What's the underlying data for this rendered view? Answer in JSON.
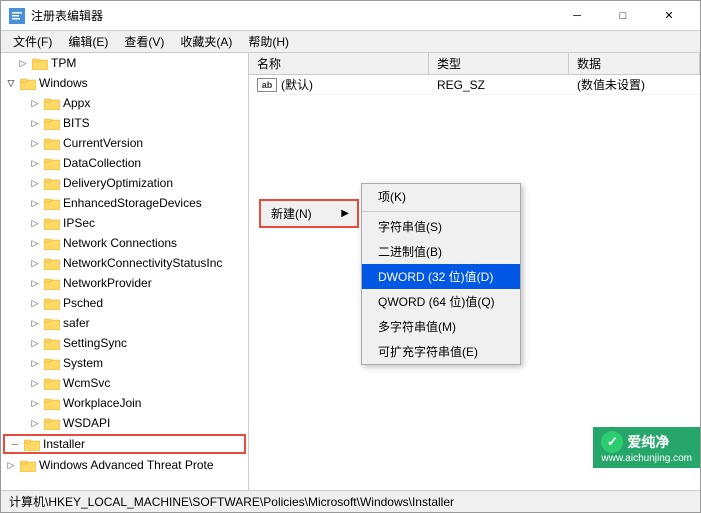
{
  "window": {
    "title": "注册表编辑器",
    "icon": "registry-editor-icon"
  },
  "titlebar": {
    "minimize": "─",
    "maximize": "□",
    "close": "✕"
  },
  "menu": {
    "items": [
      {
        "label": "文件(F)"
      },
      {
        "label": "编辑(E)"
      },
      {
        "label": "查看(V)"
      },
      {
        "label": "收藏夹(A)"
      },
      {
        "label": "帮助(H)"
      }
    ]
  },
  "tree": {
    "items": [
      {
        "id": "tpm",
        "label": "TPM",
        "indent": 1,
        "expanded": false,
        "hasChildren": true
      },
      {
        "id": "windows",
        "label": "Windows",
        "indent": 1,
        "expanded": true,
        "hasChildren": true
      },
      {
        "id": "appx",
        "label": "Appx",
        "indent": 2,
        "expanded": false,
        "hasChildren": true
      },
      {
        "id": "bits",
        "label": "BITS",
        "indent": 2,
        "expanded": false,
        "hasChildren": true
      },
      {
        "id": "currentversion",
        "label": "CurrentVersion",
        "indent": 2,
        "expanded": false,
        "hasChildren": true
      },
      {
        "id": "datacollection",
        "label": "DataCollection",
        "indent": 2,
        "expanded": false,
        "hasChildren": true
      },
      {
        "id": "deliveryoptimization",
        "label": "DeliveryOptimization",
        "indent": 2,
        "expanded": false,
        "hasChildren": true
      },
      {
        "id": "enhancedstoragedevices",
        "label": "EnhancedStorageDevices",
        "indent": 2,
        "expanded": false,
        "hasChildren": true
      },
      {
        "id": "ipsec",
        "label": "IPSec",
        "indent": 2,
        "expanded": false,
        "hasChildren": true
      },
      {
        "id": "networkconnections",
        "label": "Network Connections",
        "indent": 2,
        "expanded": false,
        "hasChildren": true
      },
      {
        "id": "networkconnectivitystatusinc",
        "label": "NetworkConnectivityStatusInc",
        "indent": 2,
        "expanded": false,
        "hasChildren": true
      },
      {
        "id": "networkprovider",
        "label": "NetworkProvider",
        "indent": 2,
        "expanded": false,
        "hasChildren": true
      },
      {
        "id": "psched",
        "label": "Psched",
        "indent": 2,
        "expanded": false,
        "hasChildren": true
      },
      {
        "id": "safer",
        "label": "safer",
        "indent": 2,
        "expanded": false,
        "hasChildren": true
      },
      {
        "id": "settingsync",
        "label": "SettingSync",
        "indent": 2,
        "expanded": false,
        "hasChildren": true
      },
      {
        "id": "system",
        "label": "System",
        "indent": 2,
        "expanded": false,
        "hasChildren": true
      },
      {
        "id": "wcmsvc",
        "label": "WcmSvc",
        "indent": 2,
        "expanded": false,
        "hasChildren": true
      },
      {
        "id": "workplacejoin",
        "label": "WorkplaceJoin",
        "indent": 2,
        "expanded": false,
        "hasChildren": true
      },
      {
        "id": "wsdapi",
        "label": "WSDAPI",
        "indent": 2,
        "expanded": false,
        "hasChildren": true
      },
      {
        "id": "installer",
        "label": "Installer",
        "indent": 1,
        "expanded": false,
        "hasChildren": true,
        "selected": true
      },
      {
        "id": "windowsadvancedthreatprote",
        "label": "Windows Advanced Threat Prote",
        "indent": 1,
        "expanded": false,
        "hasChildren": true
      }
    ]
  },
  "columns": {
    "name": "名称",
    "type": "类型",
    "data": "数据"
  },
  "table_rows": [
    {
      "name": "(默认)",
      "type": "REG_SZ",
      "data": "(数值未设置)",
      "icon": "ab"
    }
  ],
  "context_menu": {
    "new_button_label": "新建(N)",
    "arrow": "▶",
    "submenu_items": [
      {
        "label": "项(K)",
        "highlighted": false
      },
      {
        "label": "字符串值(S)",
        "highlighted": false
      },
      {
        "label": "二进制值(B)",
        "highlighted": false
      },
      {
        "label": "DWORD (32 位)值(D)",
        "highlighted": true
      },
      {
        "label": "QWORD (64 位)值(Q)",
        "highlighted": false
      },
      {
        "label": "多字符串值(M)",
        "highlighted": false
      },
      {
        "label": "可扩充字符串值(E)",
        "highlighted": false
      }
    ]
  },
  "status_bar": {
    "path": "计算机\\HKEY_LOCAL_MACHINE\\SOFTWARE\\Policies\\Microsoft\\Windows\\Installer"
  },
  "watermark": {
    "line1": "www.aichunjing.com",
    "logo": "爱纯净"
  }
}
